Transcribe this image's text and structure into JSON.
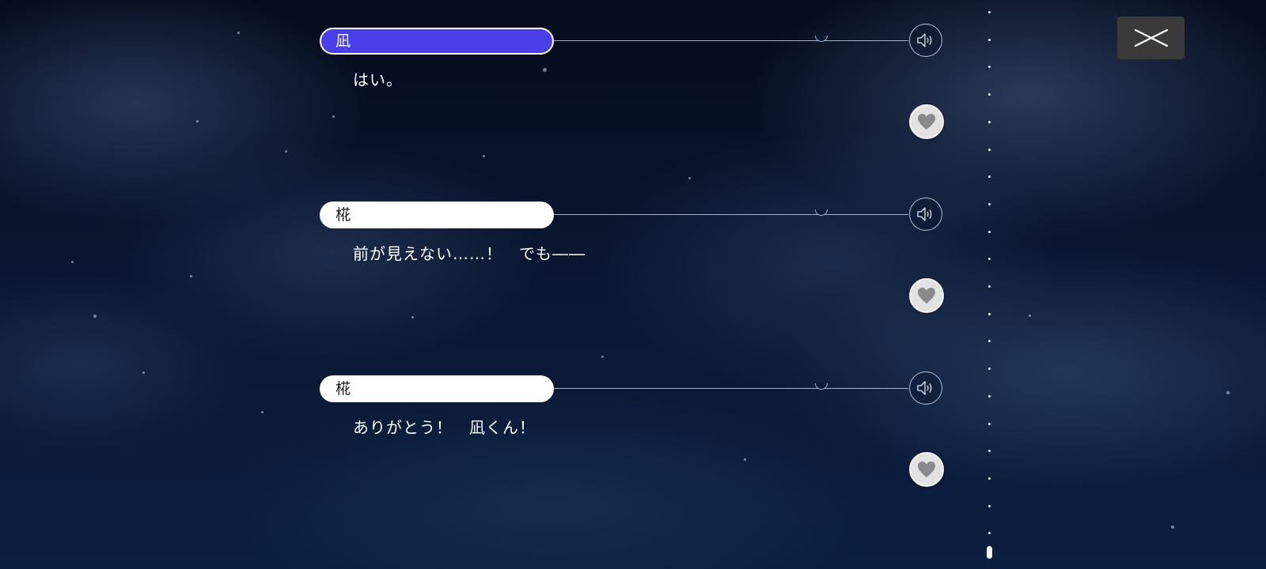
{
  "backlog": {
    "entries": [
      {
        "speaker": "凪",
        "text": "はい。",
        "active": true
      },
      {
        "speaker": "椛",
        "text": "前が見えない……！　でも――",
        "active": false
      },
      {
        "speaker": "椛",
        "text": "ありがとう！　凪くん！",
        "active": false
      }
    ],
    "voice_icon": "speaker-icon",
    "favorite_icon": "heart-icon"
  },
  "scrollbar": {
    "position": 1.0
  },
  "close_icon": "close-icon",
  "colors": {
    "active_name_bg": "#4a3ee6",
    "name_bg": "#ffffff",
    "close_bg": "#3a3a3a"
  }
}
